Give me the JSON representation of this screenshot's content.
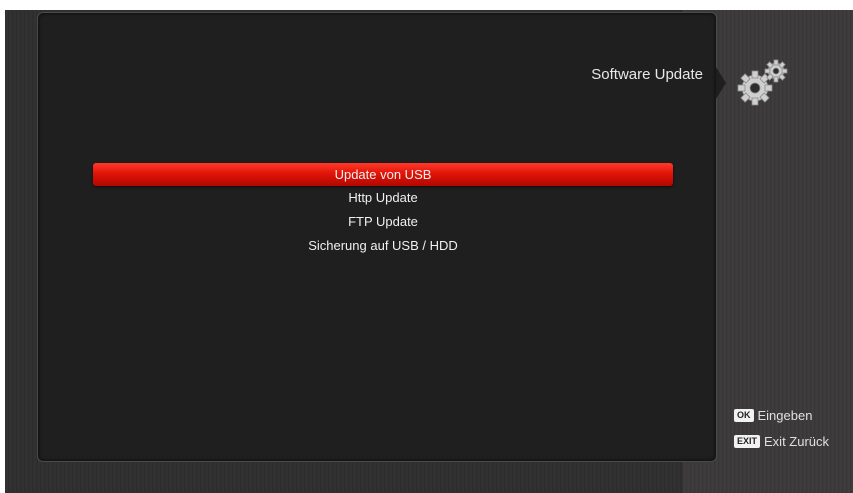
{
  "header": {
    "title": "Software Update",
    "icon": "gears-icon"
  },
  "menu": {
    "items": [
      {
        "label": "Update von USB",
        "selected": true
      },
      {
        "label": "Http Update",
        "selected": false
      },
      {
        "label": "FTP Update",
        "selected": false
      },
      {
        "label": "Sicherung auf USB / HDD",
        "selected": false
      }
    ]
  },
  "hints": {
    "ok_key": "OK",
    "ok_label": "Eingeben",
    "exit_key": "EXIT",
    "exit_label": "Exit Zurück"
  },
  "colors": {
    "selection": "#e01408",
    "panel": "#1f1f1f",
    "background": "#2e2e2e"
  }
}
